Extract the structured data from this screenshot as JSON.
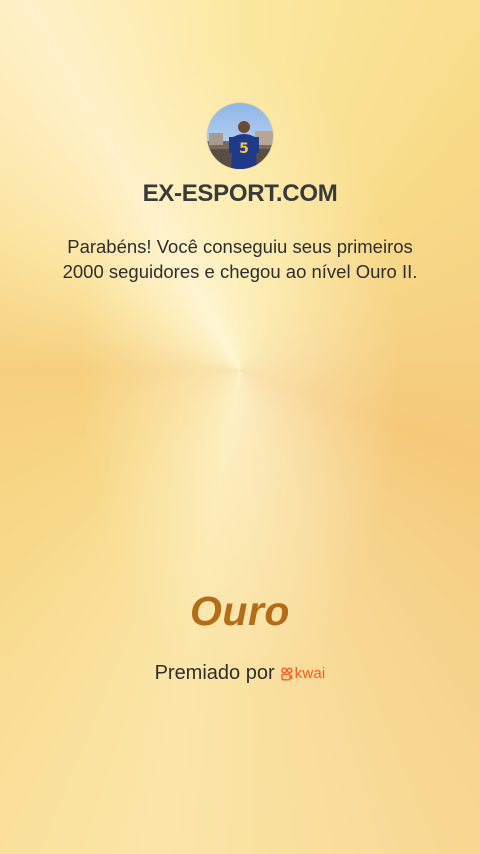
{
  "profile": {
    "username": "EX-ESPORT.COM"
  },
  "achievement": {
    "message": "Parabéns! Você conseguiu seus primeiros 2000 seguidores e chegou ao nível Ouro II.",
    "level_title": "Ouro"
  },
  "footer": {
    "awarded_by_label": "Premiado por",
    "brand_name": "kwai",
    "brand_icon": "kwai-logo-icon"
  },
  "colors": {
    "level_title": "#b46c17",
    "brand": "#ff5a1f",
    "text": "#2e2e2e",
    "background": "#f8dc8a"
  }
}
